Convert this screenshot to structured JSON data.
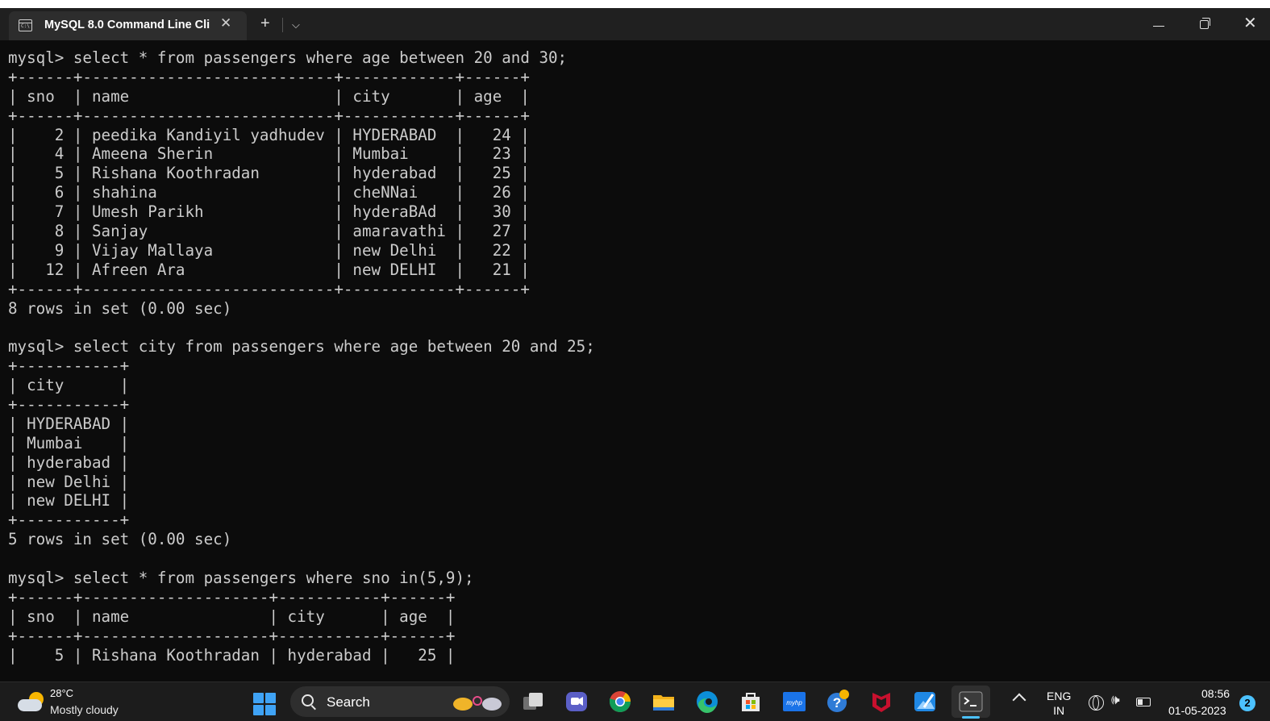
{
  "window": {
    "tab_title": "MySQL 8.0 Command Line Cli",
    "tab_icon": "terminal-icon",
    "tab_close": "✕",
    "new_tab": "+",
    "dropdown": "⌵",
    "minimize": "minimize-icon",
    "restore": "restore-icon",
    "close": "✕"
  },
  "console_lines": [
    "mysql> select * from passengers where age between 20 and 30;",
    "+------+---------------------------+------------+------+",
    "| sno  | name                      | city       | age  |",
    "+------+---------------------------+------------+------+",
    "|    2 | peedika Kandiyil yadhudev | HYDERABAD  |   24 |",
    "|    4 | Ameena Sherin             | Mumbai     |   23 |",
    "|    5 | Rishana Koothradan        | hyderabad  |   25 |",
    "|    6 | shahina                   | cheNNai    |   26 |",
    "|    7 | Umesh Parikh              | hyderaBAd  |   30 |",
    "|    8 | Sanjay                    | amaravathi |   27 |",
    "|    9 | Vijay Mallaya             | new Delhi  |   22 |",
    "|   12 | Afreen Ara                | new DELHI  |   21 |",
    "+------+---------------------------+------------+------+",
    "8 rows in set (0.00 sec)",
    "",
    "mysql> select city from passengers where age between 20 and 25;",
    "+-----------+",
    "| city      |",
    "+-----------+",
    "| HYDERABAD |",
    "| Mumbai    |",
    "| hyderabad |",
    "| new Delhi |",
    "| new DELHI |",
    "+-----------+",
    "5 rows in set (0.00 sec)",
    "",
    "mysql> select * from passengers where sno in(5,9);",
    "+------+--------------------+-----------+------+",
    "| sno  | name               | city      | age  |",
    "+------+--------------------+-----------+------+",
    "|    5 | Rishana Koothradan | hyderabad |   25 |"
  ],
  "taskbar": {
    "weather_temp": "28°C",
    "weather_desc": "Mostly cloudy",
    "search_label": "Search",
    "lang_top": "ENG",
    "lang_bottom": "IN",
    "time": "08:56",
    "date": "01-05-2023",
    "notification_count": "2",
    "hp_label": "myhp"
  }
}
